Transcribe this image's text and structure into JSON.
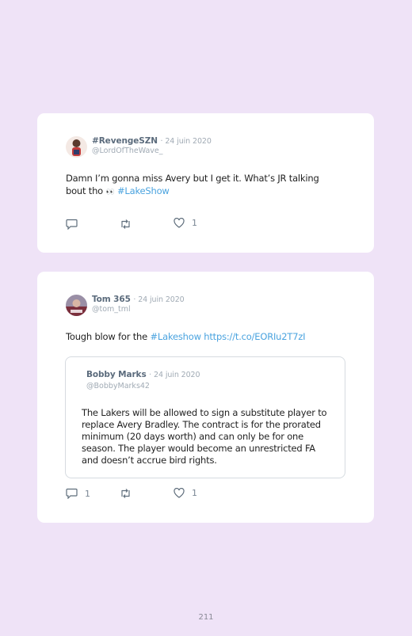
{
  "tweets": [
    {
      "name": "#RevengeSZN",
      "date": "· 24 juin 2020",
      "handle": "@LordOfTheWave_",
      "text": "Damn I’m gonna miss Avery but I get it. What’s JR talking bout tho",
      "emoji": "👀",
      "hashtag": "#LakeShow",
      "reply_count": "",
      "retweet_count": "",
      "like_count": "1"
    },
    {
      "name": "Tom 365",
      "date": "· 24 juin 2020",
      "handle": "@tom_tml",
      "text": "Tough blow for the",
      "hashtag": "#Lakeshow",
      "url": "https://t.co/EORIu2T7zI",
      "reply_count": "1",
      "retweet_count": "",
      "like_count": "1",
      "quote": {
        "name": "Bobby Marks",
        "date": "· 24 juin 2020",
        "handle": "@BobbyMarks42",
        "text": "The Lakers will be allowed to sign a substitute player to replace Avery Bradley. The contract is for the prorated minimum (20 days worth) and can only be for one season. The player would become an unrestricted FA and doesn’t accrue bird rights."
      }
    }
  ],
  "page_number": "211",
  "icons": [
    "reply-icon",
    "retweet-icon",
    "like-icon",
    "avatar"
  ],
  "colors": {
    "background": "#efe3f7",
    "card": "#ffffff",
    "link": "#4aa3df",
    "name": "#5b6b7c",
    "meta": "#a0aab4"
  }
}
